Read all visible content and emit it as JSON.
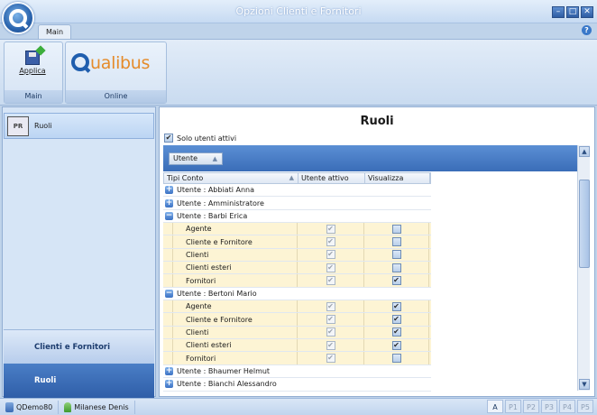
{
  "window": {
    "title": "Opzioni Clienti e Fornitori",
    "help_label": "?"
  },
  "ribbon": {
    "tab_main": "Main",
    "groups": [
      {
        "label": "Main",
        "button_label": "Applica",
        "button_icon": "save-icon"
      },
      {
        "label": "Online",
        "logo_text": "ualibus"
      }
    ]
  },
  "sidebar": {
    "top_item": {
      "label": "Ruoli",
      "icon": "roles-icon"
    },
    "bottom_items": [
      {
        "label": "Clienti e Fornitori"
      },
      {
        "label": "Ruoli",
        "active": true
      }
    ]
  },
  "main": {
    "heading": "Ruoli",
    "filter_label": "Solo utenti attivi",
    "filter_checked": true,
    "group_chip": "Utente",
    "columns": [
      "Tipi Conto",
      "Utente attivo",
      "Visualizza"
    ]
  },
  "rows": [
    {
      "type": "user",
      "label": "Utente : Abbiati Anna",
      "expanded": false
    },
    {
      "type": "user",
      "label": "Utente : Amministratore",
      "expanded": false
    },
    {
      "type": "user",
      "label": "Utente : Barbi Erica",
      "expanded": true
    },
    {
      "type": "child",
      "label": "Agente",
      "attivo": true,
      "visualizza": false
    },
    {
      "type": "child",
      "label": "Cliente e Fornitore",
      "attivo": true,
      "visualizza": false
    },
    {
      "type": "child",
      "label": "Clienti",
      "attivo": true,
      "visualizza": false
    },
    {
      "type": "child",
      "label": "Clienti esteri",
      "attivo": true,
      "visualizza": false
    },
    {
      "type": "child",
      "label": "Fornitori",
      "attivo": true,
      "visualizza": true
    },
    {
      "type": "user",
      "label": "Utente : Bertoni Mario",
      "expanded": true
    },
    {
      "type": "child",
      "label": "Agente",
      "attivo": true,
      "visualizza": true
    },
    {
      "type": "child",
      "label": "Cliente e Fornitore",
      "attivo": true,
      "visualizza": true
    },
    {
      "type": "child",
      "label": "Clienti",
      "attivo": true,
      "visualizza": true
    },
    {
      "type": "child",
      "label": "Clienti esteri",
      "attivo": true,
      "visualizza": true
    },
    {
      "type": "child",
      "label": "Fornitori",
      "attivo": true,
      "visualizza": false
    },
    {
      "type": "user",
      "label": "Utente : Bhaumer Helmut",
      "expanded": false
    },
    {
      "type": "user",
      "label": "Utente : Bianchi Alessandro",
      "expanded": false
    }
  ],
  "statusbar": {
    "database": "QDemo80",
    "user": "Milanese Denis",
    "indicators": [
      "A",
      "P1",
      "P2",
      "P3",
      "P4",
      "P5"
    ],
    "active_indicator": "A"
  }
}
